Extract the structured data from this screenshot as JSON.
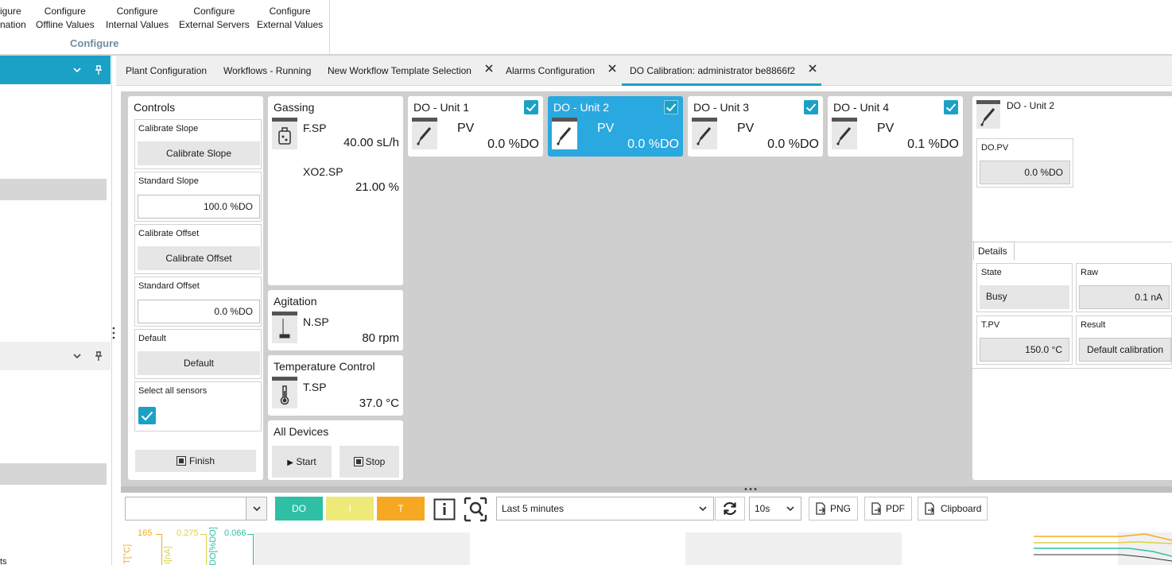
{
  "ribbon": {
    "buttons": [
      {
        "line1": "igure",
        "line2": "nation"
      },
      {
        "line1": "Configure",
        "line2": "Offline Values"
      },
      {
        "line1": "Configure",
        "line2": "Internal Values"
      },
      {
        "line1": "Configure",
        "line2": "External Servers"
      },
      {
        "line1": "Configure",
        "line2": "External Values"
      }
    ],
    "group_label": "Configure"
  },
  "left_panel": {
    "pin_glyph": "⊥",
    "bottom_text": "ts"
  },
  "tabs": [
    {
      "label": "Plant Configuration",
      "closable": false
    },
    {
      "label": "Workflows - Running",
      "closable": false
    },
    {
      "label": "New Workflow Template Selection",
      "closable": true
    },
    {
      "label": "Alarms Configuration",
      "closable": true
    },
    {
      "label": "DO Calibration: administrator be8866f2",
      "closable": true,
      "active": true
    }
  ],
  "controls": {
    "title": "Controls",
    "calibrate_slope_label": "Calibrate Slope",
    "calibrate_slope_button": "Calibrate Slope",
    "standard_slope_label": "Standard Slope",
    "standard_slope_value": "100.0 %DO",
    "calibrate_offset_label": "Calibrate Offset",
    "calibrate_offset_button": "Calibrate Offset",
    "standard_offset_label": "Standard Offset",
    "standard_offset_value": "0.0 %DO",
    "default_label": "Default",
    "default_button": "Default",
    "select_all_label": "Select all sensors",
    "select_all_checked": true,
    "finish_button": "Finish"
  },
  "gassing": {
    "title": "Gassing",
    "items": [
      {
        "name": "F.SP",
        "value": "40.00 sL/h"
      },
      {
        "name": "XO2.SP",
        "value": "21.00 %"
      }
    ]
  },
  "agitation": {
    "title": "Agitation",
    "name": "N.SP",
    "value": "80 rpm"
  },
  "temperature": {
    "title": "Temperature Control",
    "name": "T.SP",
    "value": "37.0 °C"
  },
  "all_devices": {
    "title": "All Devices",
    "start": "Start",
    "stop": "Stop"
  },
  "units": [
    {
      "title": "DO - Unit 1",
      "pv": "PV",
      "value": "0.0 %DO",
      "selected": false
    },
    {
      "title": "DO - Unit 2",
      "pv": "PV",
      "value": "0.0 %DO",
      "selected": true
    },
    {
      "title": "DO - Unit 3",
      "pv": "PV",
      "value": "0.0 %DO",
      "selected": false
    },
    {
      "title": "DO - Unit 4",
      "pv": "PV",
      "value": "0.1 %DO",
      "selected": false
    }
  ],
  "detail": {
    "title": "DO - Unit 2",
    "do_pv_label": "DO.PV",
    "do_pv_value": "0.0 %DO",
    "details_tab": "Details",
    "state_label": "State",
    "state_value": "Busy",
    "raw_label": "Raw",
    "raw_value": "0.1 nA",
    "tpv_label": "T.PV",
    "tpv_value": "150.0 °C",
    "result_label": "Result",
    "result_value": "Default calibration"
  },
  "toolbar": {
    "legend": [
      {
        "label": "DO",
        "color": "#2ebfa5",
        "text_color": "#ffffff"
      },
      {
        "label": "I",
        "color": "#eeea7a",
        "text_color": "#ffffff"
      },
      {
        "label": "T",
        "color": "#f7a823",
        "text_color": "#ffffff"
      }
    ],
    "time_range": "Last 5 minutes",
    "refresh_interval": "10s",
    "png": "PNG",
    "pdf": "PDF",
    "clipboard": "Clipboard"
  },
  "chart": {
    "axes": [
      {
        "label": "T[°C]",
        "max": "165",
        "color": "#f7a823"
      },
      {
        "label": "I[nA]",
        "max": "0.275",
        "color": "#d8d24a"
      },
      {
        "label": "DO[%DO]",
        "max": "0.066",
        "color": "#2ebfa5"
      }
    ]
  },
  "colors": {
    "accent": "#1ba1c6",
    "selected_unit": "#2aa8e0",
    "content_bg": "#cfcfcf"
  }
}
